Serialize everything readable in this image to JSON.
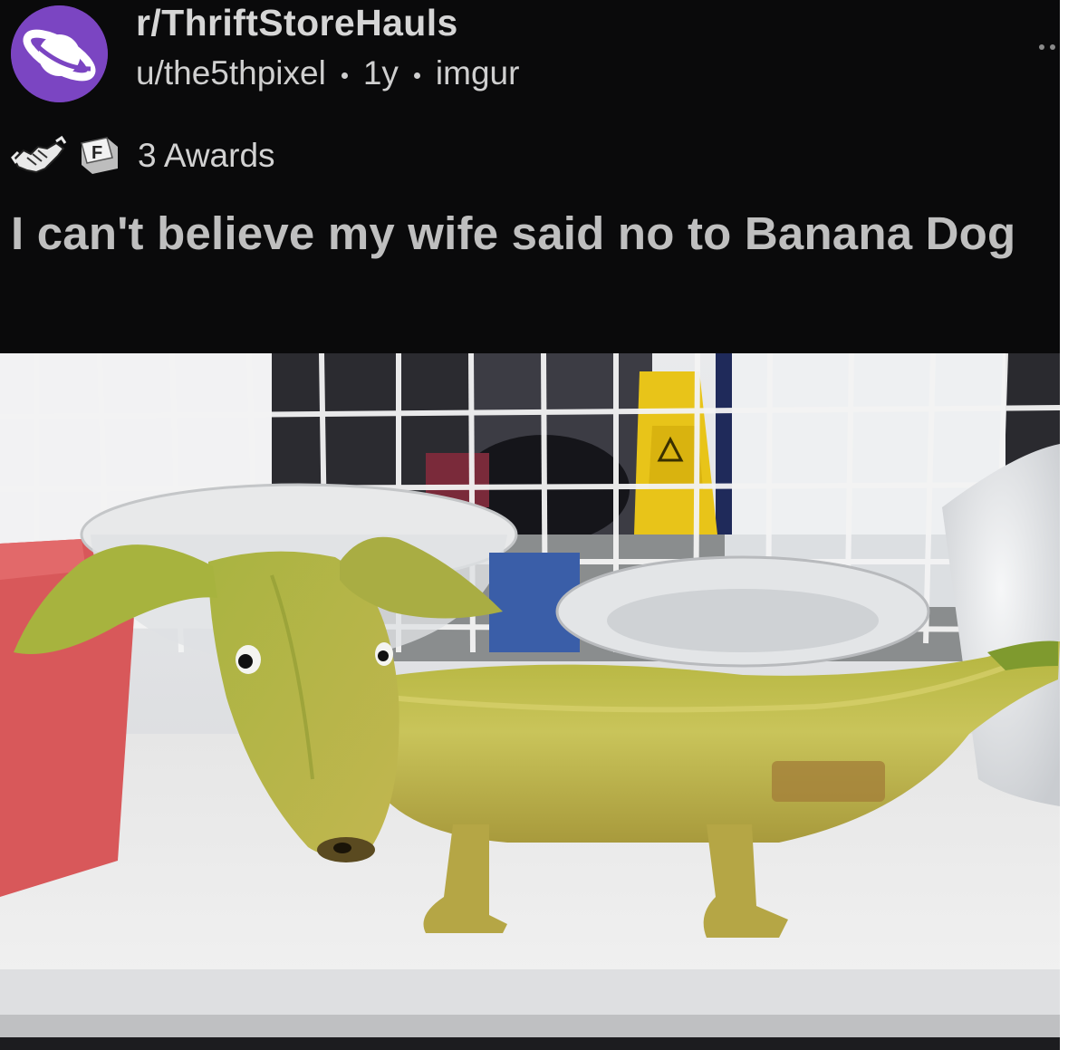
{
  "post": {
    "subreddit": "r/ThriftStoreHauls",
    "author": "u/the5thpixel",
    "age": "1y",
    "source": "imgur",
    "awards_label": "3 Awards",
    "title": "I can't believe my wife said no to Banana Dog"
  },
  "icons": {
    "subreddit_avatar": "planet-icon",
    "award_1": "handshake-award-icon",
    "award_2": "press-f-award-icon",
    "more": "more-options-icon",
    "award_2_letter": "F"
  },
  "colors": {
    "background": "#0a0a0b",
    "avatar_purple": "#7b45c2",
    "title_text": "#bfbfbf",
    "meta_text": "#cfcfcf"
  },
  "image": {
    "subject": "banana-dog-figurine-photo"
  }
}
